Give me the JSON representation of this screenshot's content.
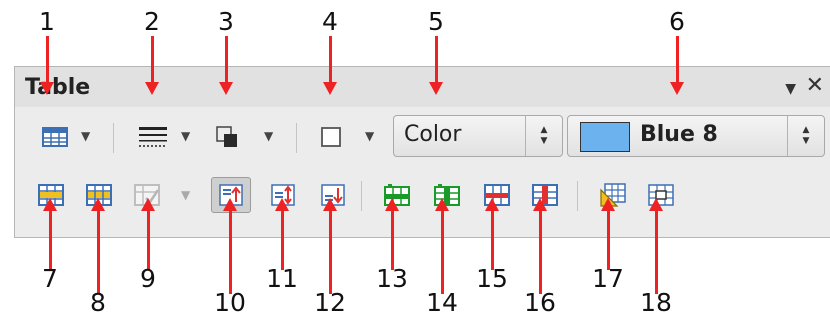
{
  "window": {
    "title": "Table",
    "menu_glyph": "▼",
    "close_glyph": "✕"
  },
  "callouts": {
    "top": [
      "1",
      "2",
      "3",
      "4",
      "5",
      "6"
    ],
    "bottom": [
      "7",
      "8",
      "9",
      "10",
      "11",
      "12",
      "13",
      "14",
      "15",
      "16",
      "17",
      "18"
    ]
  },
  "row1": {
    "dropdown_glyph": "▼",
    "area_fill": "Color",
    "area_value": "Blue 8",
    "spin_up": "▲",
    "spin_down": "▼",
    "swatch_color": "#6cb2ee"
  },
  "row2": {
    "dropdown_glyph": "▼"
  },
  "icons": {
    "row1": [
      "table-icon",
      "border-style-icon",
      "border-color-icon",
      "borders-icon"
    ],
    "row2": [
      "merge-cells-icon",
      "split-cells-icon",
      "optimize-icon",
      "align-top-icon",
      "center-vertically-icon",
      "align-bottom-icon",
      "insert-rows-icon",
      "insert-columns-icon",
      "delete-rows-icon",
      "delete-columns-icon",
      "autoformat-icon",
      "table-properties-icon"
    ]
  },
  "colors": {
    "arrow": "#ee2222",
    "panel": "#ececec",
    "table_blue": "#3d6fb5",
    "accent_yellow": "#f0c020",
    "accent_green": "#1a9a2a",
    "accent_red": "#e03030"
  }
}
